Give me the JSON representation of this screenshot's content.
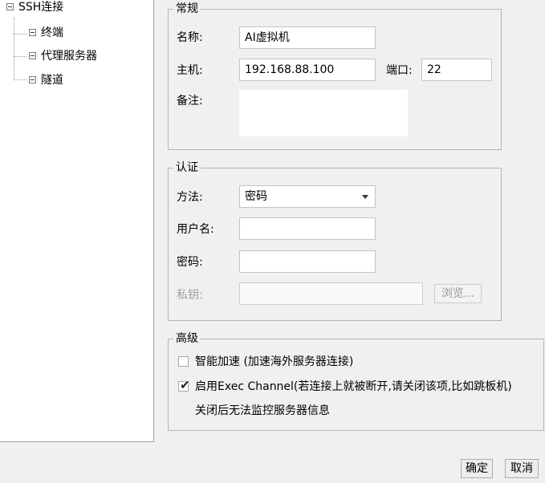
{
  "tree": {
    "root": "SSH连接",
    "children": [
      "终端",
      "代理服务器",
      "隧道"
    ]
  },
  "general": {
    "title": "常规",
    "name_label": "名称:",
    "name_value": "AI虚拟机",
    "host_label": "主机:",
    "host_value": "192.168.88.100",
    "port_label": "端口:",
    "port_value": "22",
    "notes_label": "备注:",
    "notes_value": ""
  },
  "auth": {
    "title": "认证",
    "method_label": "方法:",
    "method_value": "密码",
    "username_label": "用户名:",
    "username_value": "",
    "password_label": "密码:",
    "password_value": "",
    "private_key_label": "私钥:",
    "private_key_value": "",
    "browse_label": "浏览..."
  },
  "advanced": {
    "title": "高级",
    "smart_accel_label": "智能加速 (加速海外服务器连接)",
    "smart_accel_checked": false,
    "exec_channel_label": "启用Exec Channel(若连接上就被断开,请关闭该项,比如跳板机)",
    "exec_channel_checked": true,
    "exec_channel_note": "关闭后无法监控服务器信息"
  },
  "footer": {
    "ok_label": "确定",
    "cancel_label": "取消"
  }
}
